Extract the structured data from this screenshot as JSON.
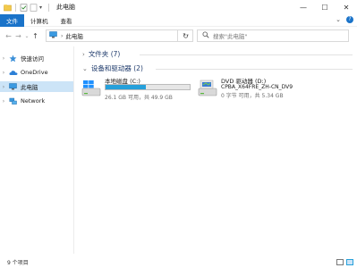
{
  "window": {
    "title": "此电脑",
    "controls": {
      "minimize": "—",
      "maximize": "☐",
      "close": "✕"
    }
  },
  "ribbon": {
    "tabs": [
      {
        "label": "文件"
      },
      {
        "label": "计算机"
      },
      {
        "label": "查看"
      }
    ],
    "expand_glyph": "⌄",
    "help_glyph": "?"
  },
  "address": {
    "back": "←",
    "forward": "→",
    "recent": "⌄",
    "up": "↑",
    "path": "此电脑",
    "separator": "›",
    "dropdown": "⌄",
    "refresh": "↻"
  },
  "search": {
    "placeholder": "搜索\"此电脑\""
  },
  "nav": {
    "items": [
      {
        "label": "快速访问",
        "chevron": "›",
        "icon": "star-icon"
      },
      {
        "label": "OneDrive",
        "chevron": "›",
        "icon": "cloud-icon"
      },
      {
        "label": "此电脑",
        "chevron": "›",
        "icon": "computer-icon",
        "selected": true
      },
      {
        "label": "Network",
        "chevron": "›",
        "icon": "network-icon"
      }
    ]
  },
  "groups": {
    "folders": {
      "label": "文件夹 (7)",
      "chevron": "›",
      "expanded": false
    },
    "devices": {
      "label": "设备和驱动器 (2)",
      "chevron": "⌄",
      "expanded": true
    }
  },
  "drives": [
    {
      "name": "本地磁盘 (C:)",
      "free": "26.1 GB 可用，共 49.9 GB",
      "used_fraction": 0.477,
      "icon": "windows-drive-icon"
    },
    {
      "name": "DVD 驱动器 (D:)",
      "label": "CPBA_X64FRE_ZH-CN_DV9",
      "free": "0 字节 可用，共 5.34 GB",
      "icon": "dvd-drive-icon"
    }
  ],
  "status": {
    "count": "9 个项目"
  },
  "colors": {
    "accent": "#1a73c9",
    "selection": "#cce4f7",
    "bar_fill": "#26a0da",
    "group_heading": "#1e3a6b"
  }
}
